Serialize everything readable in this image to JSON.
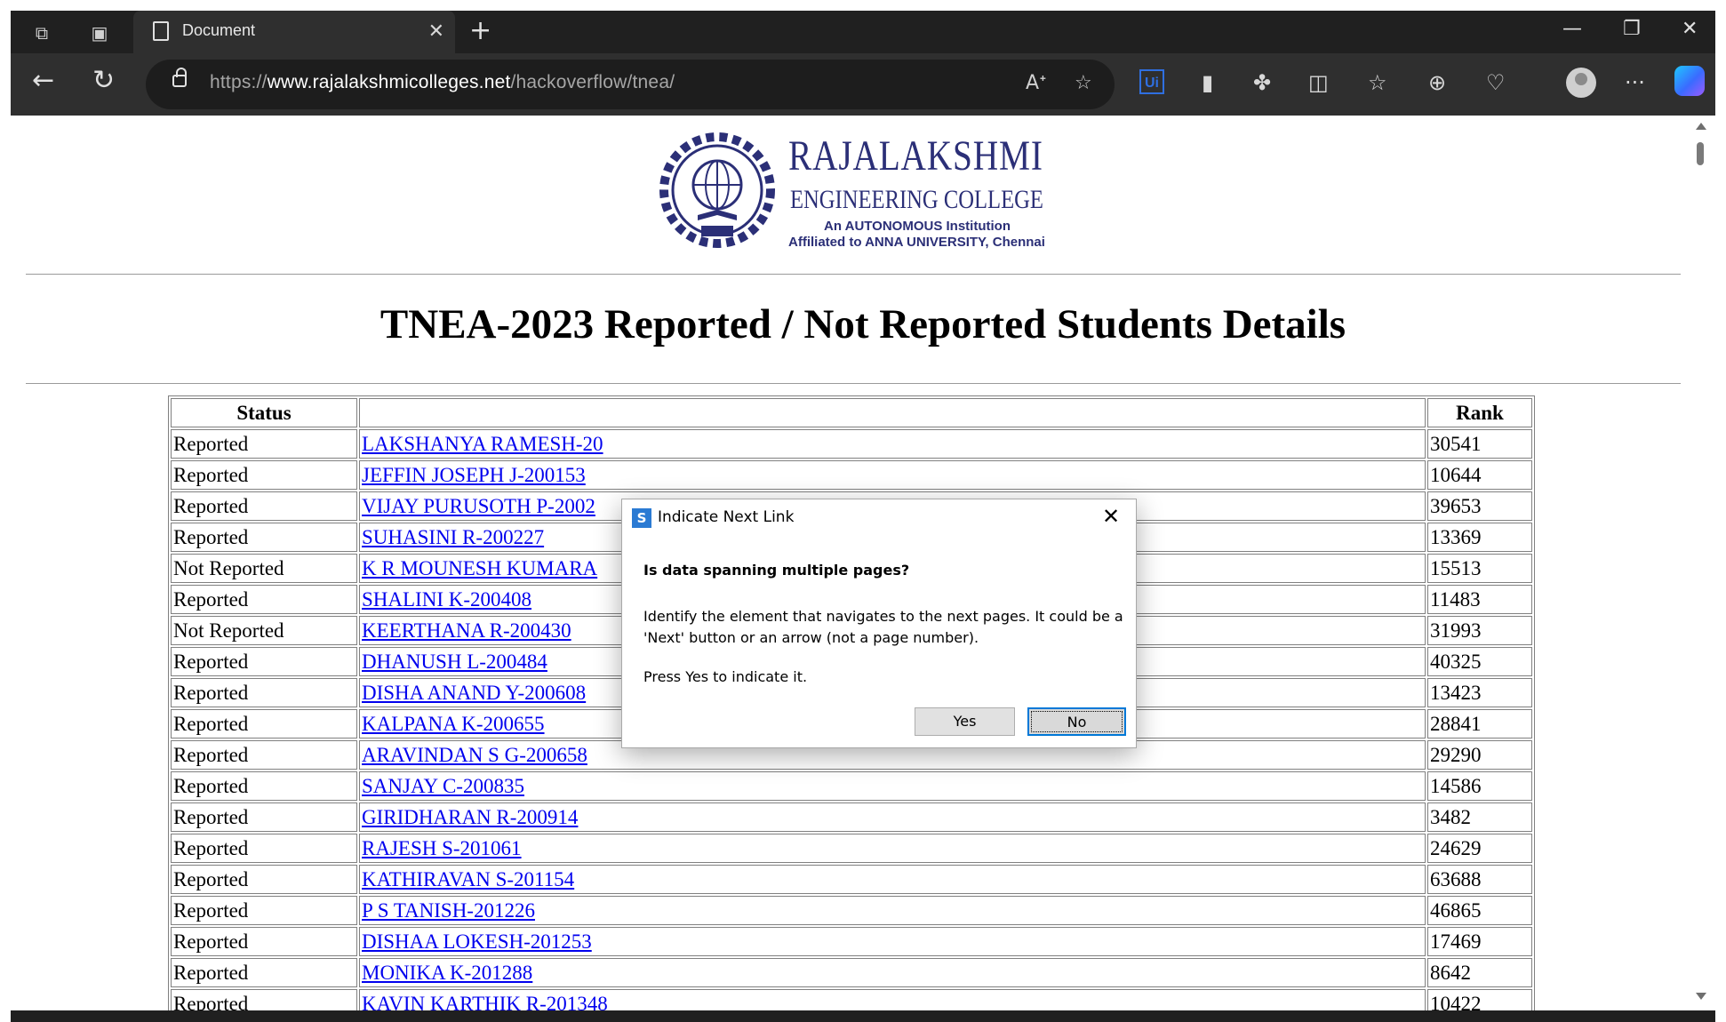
{
  "browser": {
    "tab_title": "Document",
    "tab_close": "✕",
    "new_tab": "+",
    "window_controls": {
      "minimize": "—",
      "maximize": "❐",
      "close": "✕"
    },
    "url_prefix": "https://",
    "url_host": "www.rajalakshmicolleges.net",
    "url_path": "/hackoverflow/tnea/",
    "uipath_label": "Ui",
    "more_label": "···"
  },
  "logo": {
    "line1": "RAJALAKSHMI",
    "line2": "ENGINEERING COLLEGE",
    "line3": "An AUTONOMOUS Institution",
    "line4": "Affiliated to ANNA UNIVERSITY, Chennai",
    "emblem_left": "HARDWORK",
    "emblem_right": "DISCIPLINE",
    "emblem_bottom": "REC"
  },
  "page": {
    "title": "TNEA-2023 Reported / Not Reported Students Details"
  },
  "table": {
    "headers": {
      "status": "Status",
      "name": "",
      "rank": "Rank"
    },
    "rows": [
      {
        "status": "Reported",
        "name": "LAKSHANYA RAMESH-20",
        "rank": "30541"
      },
      {
        "status": "Reported",
        "name": "JEFFIN JOSEPH J-200153",
        "rank": "10644"
      },
      {
        "status": "Reported",
        "name": "VIJAY PURUSOTH P-2002",
        "rank": "39653"
      },
      {
        "status": "Reported",
        "name": "SUHASINI R-200227",
        "rank": "13369"
      },
      {
        "status": "Not Reported",
        "name": "K R MOUNESH KUMARA",
        "rank": "15513"
      },
      {
        "status": "Reported",
        "name": "SHALINI K-200408",
        "rank": "11483"
      },
      {
        "status": "Not Reported",
        "name": "KEERTHANA R-200430",
        "rank": "31993"
      },
      {
        "status": "Reported",
        "name": "DHANUSH L-200484",
        "rank": "40325"
      },
      {
        "status": "Reported",
        "name": "DISHA ANAND Y-200608",
        "rank": "13423"
      },
      {
        "status": "Reported",
        "name": "KALPANA K-200655",
        "rank": "28841"
      },
      {
        "status": "Reported",
        "name": "ARAVINDAN S G-200658",
        "rank": "29290"
      },
      {
        "status": "Reported",
        "name": "SANJAY C-200835",
        "rank": "14586"
      },
      {
        "status": "Reported",
        "name": "GIRIDHARAN R-200914",
        "rank": "3482"
      },
      {
        "status": "Reported",
        "name": "RAJESH S-201061",
        "rank": "24629"
      },
      {
        "status": "Reported",
        "name": "KATHIRAVAN S-201154",
        "rank": "63688"
      },
      {
        "status": "Reported",
        "name": "P S TANISH-201226",
        "rank": "46865"
      },
      {
        "status": "Reported",
        "name": "DISHAA LOKESH-201253",
        "rank": "17469"
      },
      {
        "status": "Reported",
        "name": "MONIKA K-201288",
        "rank": "8642"
      },
      {
        "status": "Reported",
        "name": "KAVIN KARTHIK R-201348",
        "rank": "10422"
      }
    ]
  },
  "dialog": {
    "title": "Indicate Next Link",
    "icon_label": "S",
    "close_label": "✕",
    "question": "Is data spanning multiple pages?",
    "description": "Identify the element that navigates to the next pages. It could be a 'Next' button or an arrow (not a page number).",
    "instruction": "Press Yes to indicate it.",
    "yes_label": "Yes",
    "no_label": "No"
  }
}
